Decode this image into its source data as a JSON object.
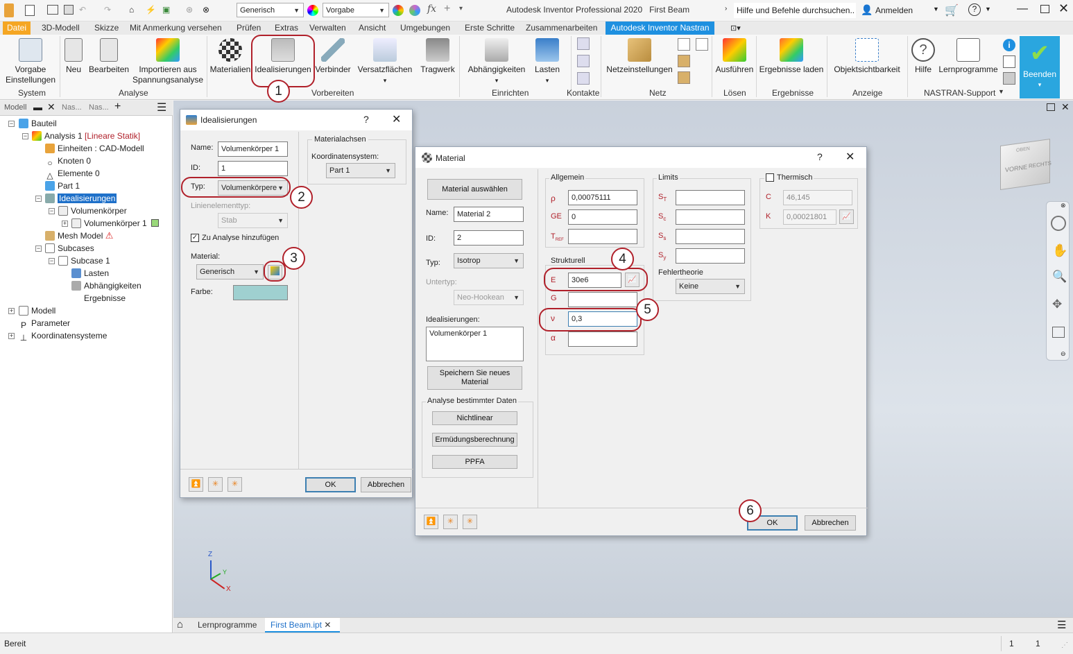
{
  "app": {
    "title": "Autodesk Inventor Professional 2020",
    "document": "First Beam",
    "search_placeholder": "Hilfe und Befehle durchsuchen..",
    "sign_in": "Anmelden",
    "quick_material": "Generisch",
    "quick_appearance": "Vorgabe"
  },
  "menu_tabs": [
    "Datei",
    "3D-Modell",
    "Skizze",
    "Mit Anmerkung versehen",
    "Prüfen",
    "Extras",
    "Verwalten",
    "Ansicht",
    "Umgebungen",
    "Erste Schritte",
    "Zusammenarbeiten",
    "Autodesk Inventor Nastran"
  ],
  "ribbon": {
    "buttons": [
      {
        "label": "Vorgabe\nEinstellungen"
      },
      {
        "label": "Neu"
      },
      {
        "label": "Bearbeiten"
      },
      {
        "label": "Importieren aus\nSpannungsanalyse"
      },
      {
        "label": "Materialien"
      },
      {
        "label": "Idealisierungen"
      },
      {
        "label": "Verbinder"
      },
      {
        "label": "Versatzflächen"
      },
      {
        "label": "Tragwerk"
      },
      {
        "label": "Abhängigkeiten"
      },
      {
        "label": "Lasten"
      },
      {
        "label": "Netzeinstellungen"
      },
      {
        "label": "Ausführen"
      },
      {
        "label": "Ergebnisse laden"
      },
      {
        "label": "Objektsichtbarkeit"
      },
      {
        "label": "Hilfe"
      },
      {
        "label": "Lernprogramme"
      },
      {
        "label": "Beenden"
      }
    ],
    "groups": [
      "System",
      "Analyse",
      "Vorbereiten",
      "Einrichten",
      "Kontakte",
      "Netz",
      "Lösen",
      "Ergebnisse",
      "Anzeige",
      "NASTRAN-Support"
    ]
  },
  "browser": {
    "tabs": [
      "Modell",
      "Nas...",
      "Nas..."
    ],
    "tree": [
      {
        "label": "Bauteil"
      },
      {
        "label": "Analysis 1",
        "suffix": "[Lineare Statik]"
      },
      {
        "label": "Einheiten : CAD-Modell"
      },
      {
        "label": "Knoten 0"
      },
      {
        "label": "Elemente 0"
      },
      {
        "label": "Part 1"
      },
      {
        "label": "Idealisierungen"
      },
      {
        "label": "Volumenkörper"
      },
      {
        "label": "Volumenkörper 1"
      },
      {
        "label": "Mesh Model"
      },
      {
        "label": "Subcases"
      },
      {
        "label": "Subcase 1"
      },
      {
        "label": "Lasten"
      },
      {
        "label": "Abhängigkeiten"
      },
      {
        "label": "Ergebnisse"
      },
      {
        "label": "Modell"
      },
      {
        "label": "Parameter"
      },
      {
        "label": "Koordinatensysteme"
      }
    ]
  },
  "ideal_dialog": {
    "title": "Idealisierungen",
    "help": "?",
    "name_label": "Name:",
    "name_value": "Volumenkörper 1",
    "id_label": "ID:",
    "id_value": "1",
    "type_label": "Typ:",
    "type_value": "Volumenkörpere",
    "line_type_label": "Linienelementtyp:",
    "line_type_value": "Stab",
    "add_to_analysis": "Zu Analyse hinzufügen",
    "material_label": "Material:",
    "material_value": "Generisch",
    "color_label": "Farbe:",
    "color_value": "#9fd0d0",
    "axes_group": "Materialachsen",
    "coord_label": "Koordinatensystem:",
    "coord_value": "Part 1",
    "ok": "OK",
    "cancel": "Abbrechen"
  },
  "material_dialog": {
    "title": "Material",
    "help": "?",
    "select_button": "Material auswählen",
    "name_label": "Name:",
    "name_value": "Material 2",
    "id_label": "ID:",
    "id_value": "2",
    "type_label": "Typ:",
    "type_value": "Isotrop",
    "subtype_label": "Untertyp:",
    "subtype_value": "Neo-Hookean",
    "ideal_label": "Idealisierungen:",
    "ideal_list": [
      "Volumenkörper 1"
    ],
    "save_button": "Speichern Sie neues Material",
    "analysis_group": "Analyse bestimmter Daten",
    "nonlinear": "Nichtlinear",
    "fatigue": "Ermüdungsberechnung",
    "ppfa": "PPFA",
    "general_group": "Allgemein",
    "rho_label": "ρ",
    "rho_value": "0,00075111",
    "ge_label": "GE",
    "ge_value": "0",
    "tref_label": "T",
    "tref_sub": "REF",
    "structural_group": "Strukturell",
    "e_label": "E",
    "e_value": "30e6",
    "g_label": "G",
    "nu_label": "ν",
    "nu_value": "0,3",
    "alpha_label": "α",
    "limits_group": "Limits",
    "st_label": "S",
    "st_sub": "T",
    "sc_label": "S",
    "sc_sub": "c",
    "ss_label": "S",
    "ss_sub": "s",
    "sy_label": "S",
    "sy_sub": "y",
    "failure_label": "Fehlertheorie",
    "failure_value": "Keine",
    "thermal_label": "Thermisch",
    "c_label": "C",
    "c_value": "46,145",
    "k_label": "K",
    "k_value": "0,00021801",
    "ok": "OK",
    "cancel": "Abbrechen"
  },
  "markers": [
    "1",
    "2",
    "3",
    "4",
    "5",
    "6"
  ],
  "doc_tabs": {
    "home": "Lernprogramme",
    "active": "First Beam.ipt"
  },
  "status": {
    "text": "Bereit",
    "count1": "1",
    "count2": "1"
  },
  "viewcube": {
    "front": "VORNE",
    "right": "RECHTS",
    "top": "OBEN"
  },
  "triad": {
    "x": "X",
    "y": "Y",
    "z": "Z"
  },
  "colors": {
    "accent": "#1e90e0",
    "nastran_tab": "#1e90e0",
    "file_tab": "#f5a623",
    "marker": "#b0202a",
    "finish": "#2aa6df"
  }
}
